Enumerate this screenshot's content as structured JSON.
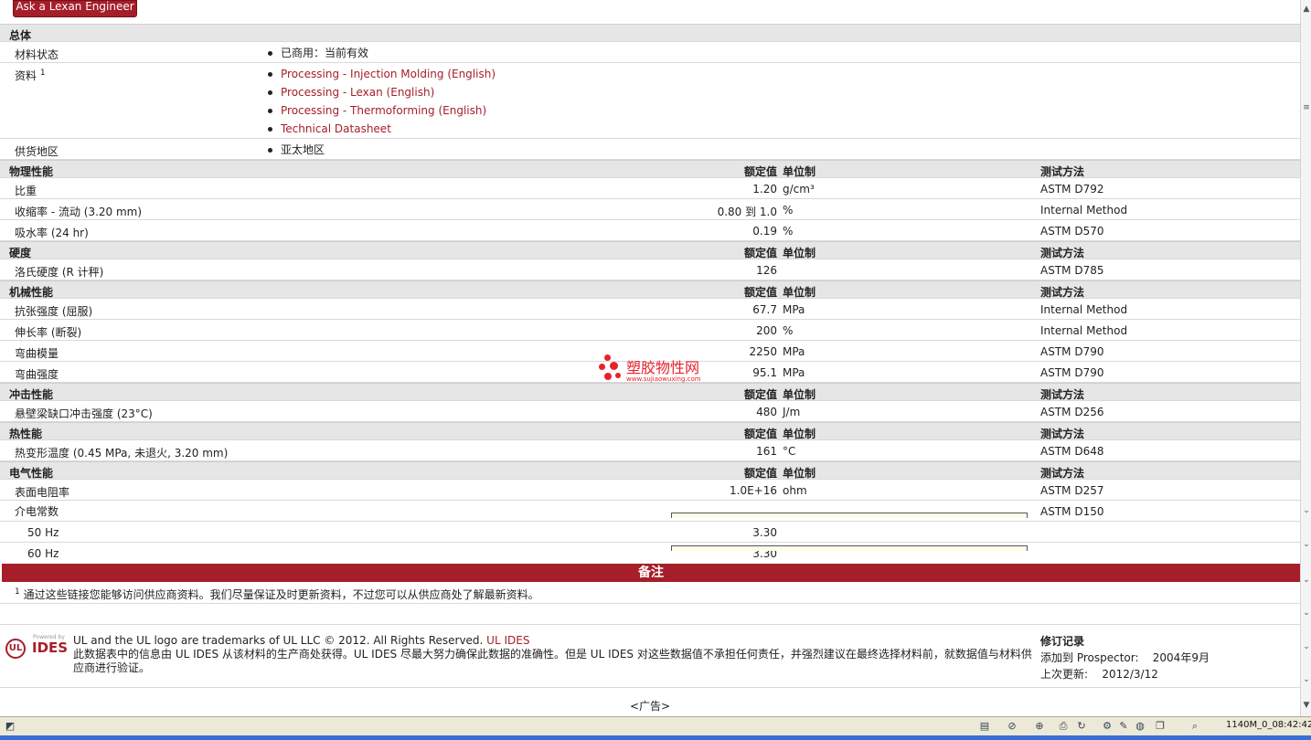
{
  "ask_button": "Ask a Lexan Engineer",
  "sections": {
    "general": "总体",
    "physical": "物理性能",
    "hardness": "硬度",
    "mechanical": "机械性能",
    "impact": "冲击性能",
    "thermal": "热性能",
    "electrical": "电气性能"
  },
  "col_headers": {
    "value": "额定值",
    "unit": "单位制",
    "test": "测试方法"
  },
  "general": {
    "status_label": "材料状态",
    "status_value": "已商用：当前有效",
    "docs_label": "资料",
    "docs_sup": "1",
    "docs": [
      "Processing - Injection Molding (English)",
      "Processing - Lexan (English)",
      "Processing - Thermoforming (English)",
      "Technical Datasheet"
    ],
    "region_label": "供货地区",
    "region_value": "亚太地区"
  },
  "physical": [
    {
      "name": "比重",
      "value": "1.20",
      "unit": "g/cm³",
      "test": "ASTM D792"
    },
    {
      "name": "收缩率  - 流动  (3.20 mm)",
      "value": "0.80 到  1.0",
      "unit": "%",
      "test": "Internal Method"
    },
    {
      "name": "吸水率  (24 hr)",
      "value": "0.19",
      "unit": "%",
      "test": "ASTM D570"
    }
  ],
  "hardness": [
    {
      "name": "洛氏硬度  (R 计秤)",
      "value": "126",
      "unit": "",
      "test": "ASTM D785"
    }
  ],
  "mechanical": [
    {
      "name": "抗张强度  (屈服)",
      "value": "67.7",
      "unit": "MPa",
      "test": "Internal Method"
    },
    {
      "name": "伸长率  (断裂)",
      "value": "200",
      "unit": "%",
      "test": "Internal Method"
    },
    {
      "name": "弯曲模量",
      "value": "2250",
      "unit": "MPa",
      "test": "ASTM D790"
    },
    {
      "name": "弯曲强度",
      "value": "95.1",
      "unit": "MPa",
      "test": "ASTM D790"
    }
  ],
  "impact": [
    {
      "name": "悬壁梁缺口冲击强度  (23°C)",
      "value": "480",
      "unit": "J/m",
      "test": "ASTM D256"
    }
  ],
  "thermal": [
    {
      "name": "热变形温度  (0.45 MPa, 未退火, 3.20 mm)",
      "value": "161",
      "unit": "°C",
      "test": "ASTM D648"
    }
  ],
  "electrical": [
    {
      "name": "表面电阻率",
      "value": "1.0E+16",
      "unit": "ohm",
      "test": "ASTM D257"
    },
    {
      "name": "介电常数",
      "value": "",
      "unit": "",
      "test": "ASTM D150"
    },
    {
      "name": "50 Hz",
      "value": "3.30",
      "unit": "",
      "test": ""
    },
    {
      "name": "60 Hz",
      "value": "3.30",
      "unit": "",
      "test": ""
    }
  ],
  "watermark": {
    "title": "塑胶物性网",
    "url": "www.sujiaowuxing.com"
  },
  "notes": {
    "title": "备注",
    "sup": "1",
    "text": "通过这些链接您能够访问供应商资料。我们尽量保证及时更新资料，不过您可以从供应商处了解最新资料。"
  },
  "footer": {
    "logo_powered": "Powered by",
    "logo_ul": "UL",
    "logo_ides": "IDES",
    "copyright": "UL and the UL logo are trademarks of UL LLC © 2012. All Rights Reserved. ",
    "copyright_link": "UL IDES",
    "disclaimer": "此数据表中的信息由  UL IDES 从该材料的生产商处获得。UL IDES 尽最大努力确保此数据的准确性。但是  UL IDES 对这些数据值不承担任何责任，并强烈建议在最终选择材料前，就数据值与材料供应商进行验证。",
    "rev_title": "修订记录",
    "added_label": "添加到  Prospector:",
    "added_value": "2004年9月",
    "updated_label": "上次更新:",
    "updated_value": "2012/3/12",
    "ad": "<广告>"
  },
  "statusbar": {
    "text": "1140M_0_08:42:42"
  }
}
